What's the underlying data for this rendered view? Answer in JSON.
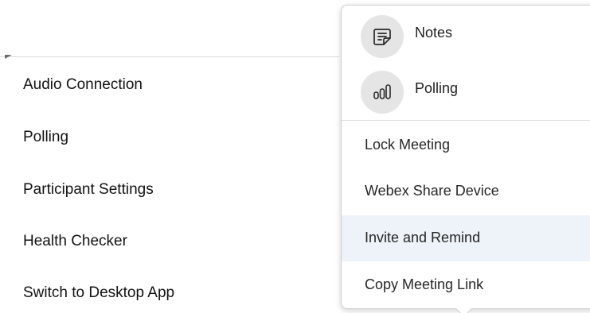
{
  "left_menu": {
    "items": [
      {
        "label": "Audio Connection"
      },
      {
        "label": "Polling"
      },
      {
        "label": "Participant Settings"
      },
      {
        "label": "Health Checker"
      },
      {
        "label": "Switch to Desktop App"
      }
    ]
  },
  "right_menu": {
    "icon_items": [
      {
        "label": "Notes",
        "icon": "notes-icon"
      },
      {
        "label": "Polling",
        "icon": "polling-icon"
      }
    ],
    "text_items": [
      {
        "label": "Lock Meeting"
      },
      {
        "label": "Webex Share Device"
      },
      {
        "label": "Invite and Remind",
        "highlighted": true
      },
      {
        "label": "Copy Meeting Link"
      }
    ]
  },
  "colors": {
    "highlight": "#eef3f9",
    "icon_circle": "#e5e5e5",
    "text": "#121212"
  }
}
